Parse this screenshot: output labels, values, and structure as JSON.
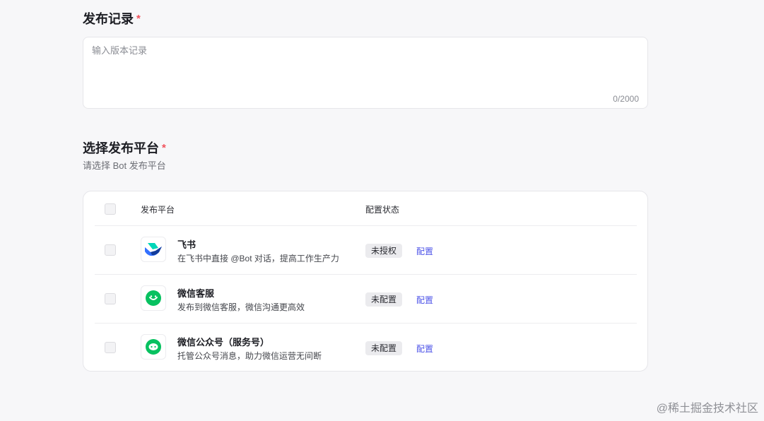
{
  "release_record": {
    "title": "发布记录",
    "required_mark": "*",
    "placeholder": "输入版本记录",
    "value": "",
    "char_count": "0/2000"
  },
  "platform_section": {
    "title": "选择发布平台",
    "required_mark": "*",
    "subtitle": "请选择 Bot 发布平台",
    "table": {
      "headers": {
        "platform": "发布平台",
        "status": "配置状态"
      },
      "rows": [
        {
          "name": "飞书",
          "desc": "在飞书中直接 @Bot 对话，提高工作生产力",
          "status": "未授权",
          "action": "配置",
          "icon": "feishu-logo-icon"
        },
        {
          "name": "微信客服",
          "desc": "发布到微信客服，微信沟通更高效",
          "status": "未配置",
          "action": "配置",
          "icon": "wechat-kefu-logo-icon"
        },
        {
          "name": "微信公众号（服务号）",
          "desc": "托管公众号消息，助力微信运营无间断",
          "status": "未配置",
          "action": "配置",
          "icon": "wechat-official-account-logo-icon"
        }
      ]
    }
  },
  "watermark": "@稀土掘金技术社区",
  "colors": {
    "accent_link": "#4d53e8",
    "required": "#f1525c",
    "wechat_green": "#07c160",
    "feishu_blue": "#3370ff",
    "feishu_teal": "#00d6b9",
    "feishu_navy": "#133c9a"
  }
}
